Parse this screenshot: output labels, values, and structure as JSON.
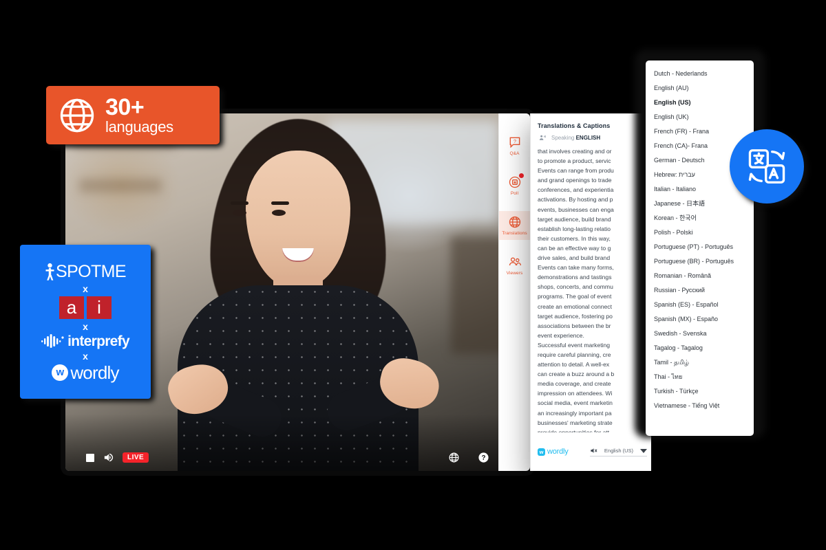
{
  "badges": {
    "languages": {
      "count": "30+",
      "label": "languages",
      "icon": "globe-icon",
      "color": "#e8552a"
    },
    "translate_circle": {
      "icon": "translate-icon",
      "color": "#1575f5"
    },
    "partners": {
      "color": "#1575f5",
      "spotme": "SPOTME",
      "x1": "x",
      "ai": [
        "a",
        "i"
      ],
      "x2": "x",
      "interprefy": "interprefy",
      "x3": "x",
      "wordly": "wordly",
      "wordly_mark": "w"
    }
  },
  "video": {
    "controls_left": {
      "stop": "stop-button",
      "volume": "volume-icon",
      "live_label": "LIVE"
    },
    "controls_right": {
      "globe": "globe-icon",
      "help": "help-icon",
      "fullscreen": "fullscreen-icon"
    }
  },
  "rail": {
    "items": [
      {
        "label": "Q&A",
        "icon": "question-bubble-icon",
        "active": false,
        "badge": false
      },
      {
        "label": "Poll",
        "icon": "poll-icon",
        "active": false,
        "badge": true
      },
      {
        "label": "Translations",
        "icon": "globe-icon",
        "active": true,
        "badge": false
      },
      {
        "label": "Viewers",
        "icon": "viewers-icon",
        "active": false,
        "badge": false
      }
    ]
  },
  "panel": {
    "title": "Translations & Captions",
    "speaking_prefix": "Speaking",
    "speaking_language": "ENGLISH",
    "transcript": "that involves creating and or\nto promote a product, servic\nEvents can range from produ\nand grand openings to trade\nconferences, and experientia\nactivations. By hosting and p\nevents, businesses can enga\ntarget audience, build brand\nestablish long-lasting relatio\ntheir customers. In this way,\ncan be an effective way to g\ndrive sales, and build brand\nEvents can take many forms,\ndemonstrations and tastings\nshops, concerts, and commu\nprograms. The goal of event\ncreate an emotional connect\ntarget audience, fostering po\nassociations between the br\nevent experience.\nSuccessful event marketing\nrequire careful planning, cre\nattention to detail. A well-ex\ncan create a buzz around a b\nmedia coverage, and create\nimpression on attendees. Wi\nsocial media, event marketin\nan increasingly important pa\nbusinesses' marketing strate\nprovide opportunities for att\ntheir experiences on social n\namplifying the reach and imp\nevent.",
    "footer": {
      "brand": "wordly",
      "brand_mark": "w",
      "mute_icon": "mute-icon",
      "selected_language": "English (US)",
      "caret_icon": "chevron-down-icon"
    }
  },
  "language_dropdown": {
    "selected": "English (US)",
    "options": [
      "Dutch - Nederlands",
      "English (AU)",
      "English (US)",
      "English (UK)",
      "French (FR) - Frana",
      "French (CA)- Frana",
      "German - Deutsch",
      "Hebrew: עברית",
      "Italian - Italiano",
      "Japanese - 日本語",
      "Korean - 한국어",
      "Polish - Polski",
      "Portuguese (PT) - Português",
      "Portuguese (BR) - Português",
      "Romanian - Română",
      "Russian - Русский",
      "Spanish (ES) - Español",
      "Spanish (MX) - Españo",
      "Swedish - Svenska",
      "Tagalog - Tagalog",
      "Tamil - தமிழ்",
      "Thai - ไทย",
      "Turkish - Türkçe",
      "Vietnamese - Tiếng Việt"
    ]
  }
}
